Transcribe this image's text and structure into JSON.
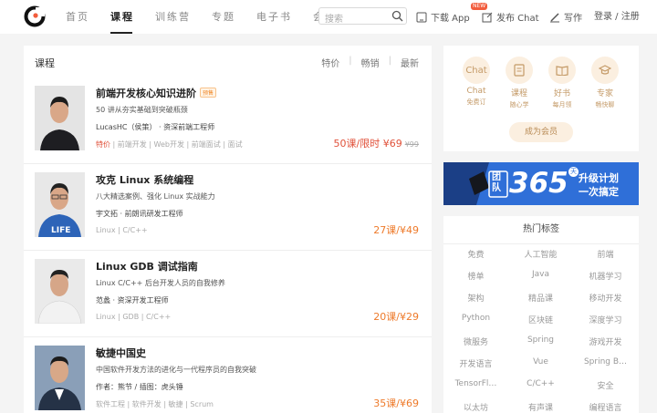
{
  "nav": {
    "items": [
      {
        "label": "首页",
        "active": false
      },
      {
        "label": "课程",
        "active": true
      },
      {
        "label": "训练营",
        "active": false
      },
      {
        "label": "专题",
        "active": false
      },
      {
        "label": "电子书",
        "active": false
      },
      {
        "label": "会员",
        "active": false
      }
    ],
    "search_placeholder": "搜索",
    "download_app": "下载 App",
    "new_badge": "NEW",
    "publish_chat": "发布 Chat",
    "write": "写作",
    "login_register": "登录 / 注册"
  },
  "main": {
    "title": "课程",
    "sorts": [
      "特价",
      "畅销",
      "最新"
    ],
    "courses": [
      {
        "title": "前端开发核心知识进阶",
        "badge": "预售",
        "desc": "50 讲从夯实基础到突破瓶颈",
        "author": "LucasHC（侯策） · 资深前端工程师",
        "tag_highlight": "特价",
        "tags": " | 前端开发 | Web开发 | 前端面试 | 面试",
        "price_main": "50课/限时 ¥69",
        "price_old": "¥99"
      },
      {
        "title": "攻克 Linux 系统编程",
        "desc": "八大精选案例、强化 Linux 实战能力",
        "author": "宇文拓 · 前朗讯研发工程师",
        "tags": "Linux | C/C++",
        "price": "27课/¥49"
      },
      {
        "title": "Linux GDB 调试指南",
        "desc": "Linux C/C++ 后台开发人员的自我修养",
        "author": "范蠡 · 资深开发工程师",
        "tags": "Linux | GDB | C/C++",
        "price": "20课/¥29"
      },
      {
        "title": "敏捷中国史",
        "desc": "中国软件开发方法的进化与一代程序员的自我突破",
        "author": "作者：熊节 / 插图：虎头锤",
        "tags": "软件工程 | 软件开发 | 敏捷 | Scrum",
        "price": "35课/¥69"
      }
    ]
  },
  "member": {
    "items": [
      {
        "icon_text": "Chat",
        "name": "Chat",
        "sub": "免费订"
      },
      {
        "icon_text": "",
        "name": "课程",
        "sub": "随心学"
      },
      {
        "icon_text": "",
        "name": "好书",
        "sub": "每月领"
      },
      {
        "icon_text": "",
        "name": "专家",
        "sub": "畅快聊"
      }
    ],
    "button": "成为会员"
  },
  "banner": {
    "tuandui": "团队",
    "number": "365",
    "day": "天",
    "line1": "升级计划",
    "line2": "一次搞定"
  },
  "hot_tags": {
    "title": "热门标签",
    "tags": [
      "免费",
      "人工智能",
      "前端",
      "榜单",
      "Java",
      "机器学习",
      "架构",
      "精品课",
      "移动开发",
      "Python",
      "区块链",
      "深度学习",
      "微服务",
      "Spring",
      "游戏开发",
      "开发语言",
      "Vue",
      "Spring B…",
      "TensorFl…",
      "C/C++",
      "安全",
      "以太坊",
      "有声课",
      "编程语言"
    ]
  },
  "colors": {
    "accent_red": "#e0513a",
    "price_orange": "#ee7a2a",
    "gold": "#c49a67",
    "banner_blue": "#2f6fd8"
  }
}
